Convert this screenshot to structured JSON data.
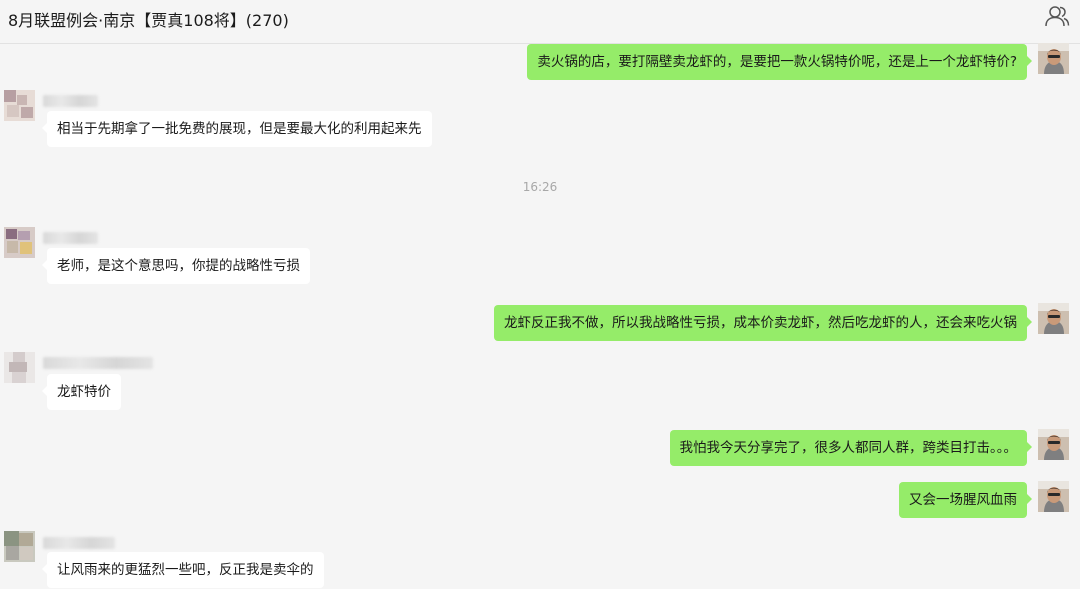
{
  "header": {
    "title": "8月联盟例会·南京【贾真108将】(270)",
    "members_icon": "group-members-icon"
  },
  "timestamp": "16:26",
  "messages": [
    {
      "side": "out",
      "text": "卖火锅的店，要打隔壁卖龙虾的，是要把一款火锅特价呢，还是上一个龙虾特价?"
    },
    {
      "side": "in",
      "text": "相当于先期拿了一批免费的展现，但是要最大化的利用起来先"
    },
    {
      "side": "in",
      "text": "老师，是这个意思吗，你提的战略性亏损"
    },
    {
      "side": "out",
      "text": "龙虾反正我不做，所以我战略性亏损，成本价卖龙虾，然后吃龙虾的人，还会来吃火锅"
    },
    {
      "side": "in",
      "text": "龙虾特价"
    },
    {
      "side": "out",
      "text": "我怕我今天分享完了，很多人都同人群，跨类目打击。。。"
    },
    {
      "side": "out",
      "text": "又会一场腥风血雨"
    },
    {
      "side": "in",
      "text": "让风雨来的更猛烈一些吧，反正我是卖伞的"
    }
  ],
  "colors": {
    "outgoing_bubble": "#95ec69",
    "incoming_bubble": "#ffffff",
    "background": "#f5f5f5"
  }
}
